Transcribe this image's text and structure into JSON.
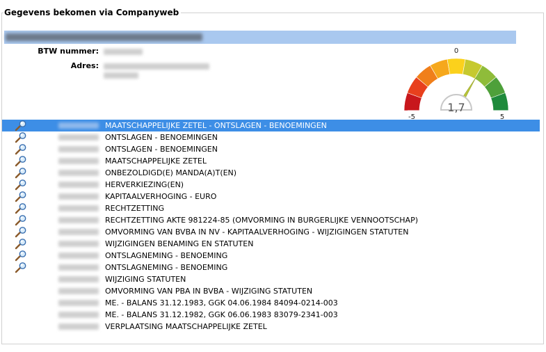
{
  "panel": {
    "title": "Gegevens bekomen via Companyweb"
  },
  "company": {
    "btw_label": "BTW nummer:",
    "adres_label": "Adres:"
  },
  "gauge": {
    "value_label": "1,7",
    "value": 1.7,
    "min_label": "-5",
    "mid_label": "0",
    "max_label": "5",
    "min": -5,
    "max": 5,
    "segment_colors": [
      "#c8171c",
      "#e8401d",
      "#f07f1a",
      "#f6a81c",
      "#fbd11c",
      "#c6c92f",
      "#8fbc3a",
      "#4ea03a",
      "#1e8a3b"
    ]
  },
  "publications": [
    {
      "text": "MAATSCHAPPELIJKE ZETEL - ONTSLAGEN - BENOEMINGEN",
      "has_icon": true,
      "selected": true
    },
    {
      "text": "ONTSLAGEN - BENOEMINGEN",
      "has_icon": true
    },
    {
      "text": "ONTSLAGEN - BENOEMINGEN",
      "has_icon": true
    },
    {
      "text": "MAATSCHAPPELIJKE ZETEL",
      "has_icon": true
    },
    {
      "text": "ONBEZOLDIGD(E) MANDA(A)T(EN)",
      "has_icon": true
    },
    {
      "text": "HERVERKIEZING(EN)",
      "has_icon": true
    },
    {
      "text": "KAPITAALVERHOGING - EURO",
      "has_icon": true
    },
    {
      "text": "RECHTZETTING",
      "has_icon": true
    },
    {
      "text": "RECHTZETTING AKTE 981224-85 (OMVORMING IN BURGERLIJKE VENNOOTSCHAP)",
      "has_icon": true
    },
    {
      "text": "OMVORMING VAN BVBA IN NV - KAPITAALVERHOGING - WIJZIGINGEN STATUTEN",
      "has_icon": true
    },
    {
      "text": "WIJZIGINGEN BENAMING EN STATUTEN",
      "has_icon": true
    },
    {
      "text": "ONTSLAGNEMING - BENOEMING",
      "has_icon": true
    },
    {
      "text": "ONTSLAGNEMING - BENOEMING",
      "has_icon": true
    },
    {
      "text": "WIJZIGING STATUTEN",
      "has_icon": false
    },
    {
      "text": "OMVORMING VAN PBA IN BVBA - WIJZIGING STATUTEN",
      "has_icon": false
    },
    {
      "text": "ME. - BALANS 31.12.1983, GGK 04.06.1984 84094-0214-003",
      "has_icon": false
    },
    {
      "text": "ME. - BALANS 31.12.1982, GGK 06.06.1983 83079-2341-003",
      "has_icon": false
    },
    {
      "text": "VERPLAATSING MAATSCHAPPELIJKE ZETEL",
      "has_icon": false
    }
  ]
}
